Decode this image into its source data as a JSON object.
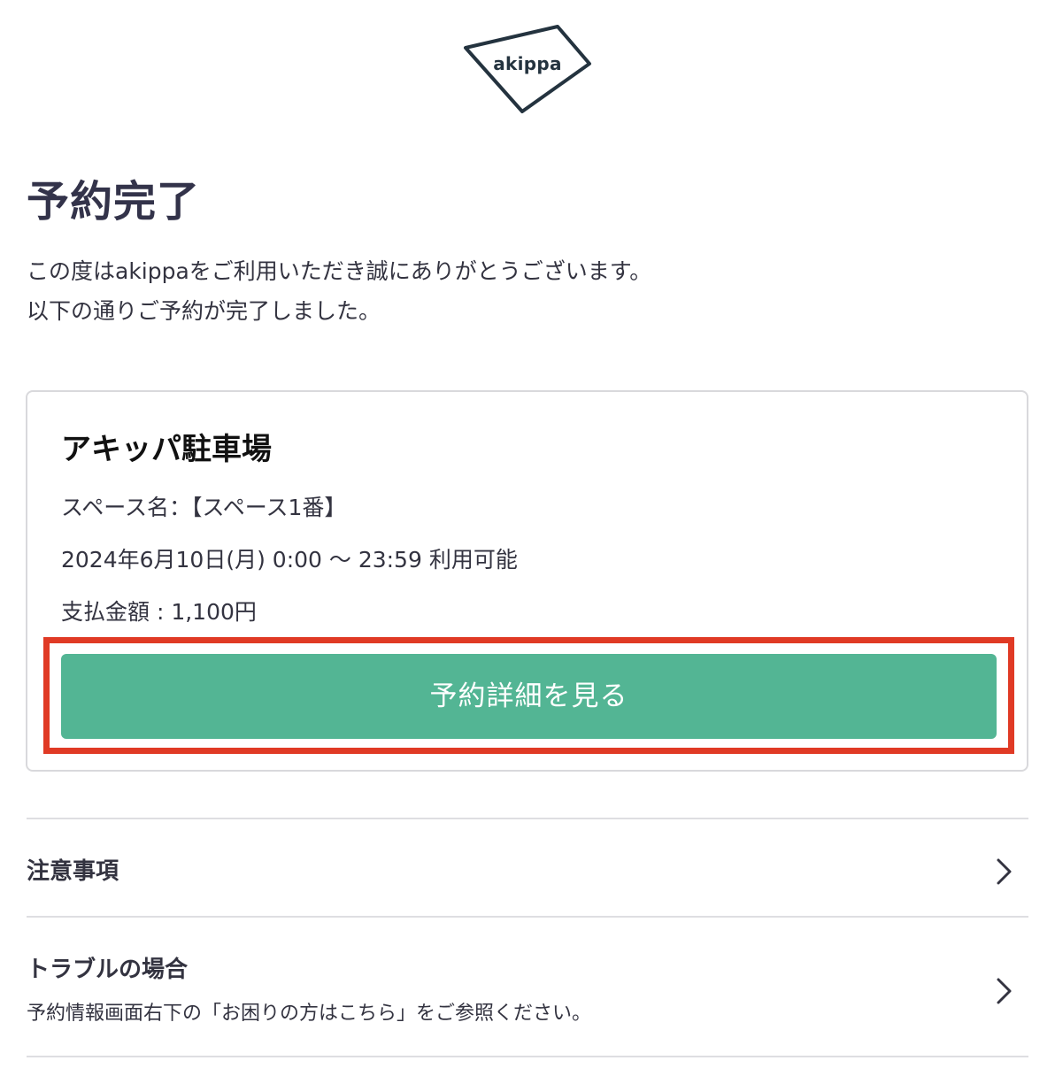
{
  "brand": {
    "logo_text": "akippa",
    "accent_color": "#53b594",
    "dark_color": "#24333f",
    "highlight_color": "#e03a25"
  },
  "page": {
    "title": "予約完了",
    "intro_line1": "この度はakippaをご利用いただき誠にありがとうございます。",
    "intro_line2": "以下の通りご予約が完了しました。"
  },
  "reservation": {
    "parking_name": "アキッパ駐車場",
    "space": "スペース名：【スペース1番】",
    "datetime": "2024年6月10日(月) 0:00 〜 23:59 利用可能",
    "price": "支払金額 : 1,100円",
    "detail_button_label": "予約詳細を見る"
  },
  "sections": {
    "caution_title": "注意事項",
    "trouble_title": "トラブルの場合",
    "trouble_description": "予約情報画面右下の「お困りの方はこちら」をご参照ください。"
  },
  "icons": {
    "logo": "akippa-logo-icon",
    "chevron": "chevron-right-icon"
  }
}
